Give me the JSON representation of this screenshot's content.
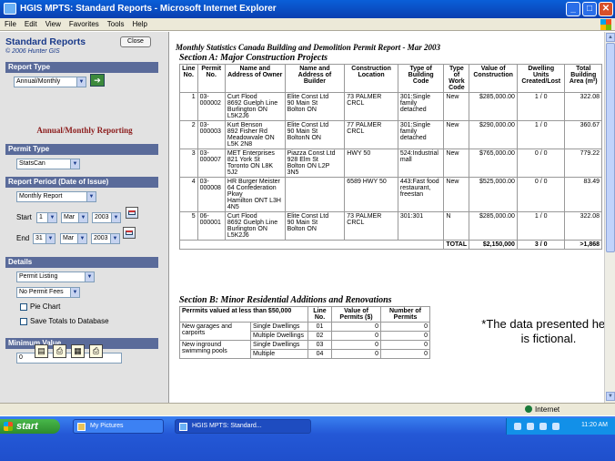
{
  "window": {
    "title": "HGIS MPTS: Standard Reports - Microsoft Internet Explorer"
  },
  "menu": [
    "File",
    "Edit",
    "View",
    "Favorites",
    "Tools",
    "Help"
  ],
  "sidebar": {
    "title": "Standard Reports",
    "copyright": "© 2006 Hunter GIS",
    "close_label": "Close",
    "report_type": {
      "heading": "Report Type",
      "value": "Annual/Monthly"
    },
    "reporting_title": "Annual/Monthly Reporting",
    "permit_type": {
      "heading": "Permit Type",
      "value": "StatsCan"
    },
    "report_period": {
      "heading": "Report Period (Date of Issue)",
      "value": "Monthly Report",
      "start_label": "Start",
      "start_day": "1",
      "start_month": "Mar",
      "start_year": "2003",
      "end_label": "End",
      "end_day": "31",
      "end_month": "Mar",
      "end_year": "2003"
    },
    "details": {
      "heading": "Details",
      "listing": "Permit Listing",
      "fees": "No Permit Fees",
      "pie_chart": "Pie Chart",
      "save_totals": "Save Totals to Database"
    },
    "minimum": {
      "heading": "Minimum Value",
      "value": "0"
    }
  },
  "report": {
    "title": "Monthly Statistics Canada Building and Demolition Permit Report - Mar 2003",
    "section_a": {
      "title": "Section A: Major Construction Projects",
      "headers": [
        "Line No.",
        "Permit No.",
        "Name and Address of Owner",
        "Name and Address of Builder",
        "Construction Location",
        "Type of Building Code",
        "Type of Work Code",
        "Value of Construction",
        "Dwelling Units Created/Lost",
        "Total Building Area (m²)"
      ],
      "rows": [
        [
          "1",
          "03-000002",
          "Curt Flood\n8692 Guelph Line\nBurlington ON\nL5K2J6",
          "Elite Const Ltd\n90 Main St\nBolton ON",
          "73 PALMER CRCL",
          "301:Single family detached",
          "New",
          "$285,000.00",
          "1 / 0",
          "322.08"
        ],
        [
          "2",
          "03-000003",
          "Kurt Benson\n892 Fisher Rd\nMeadowvale ON\nL5K 2N8",
          "Elite Const Ltd\n90 Main St\nBoltonN ON",
          "77 PALMER CRCL",
          "301:Single family detached",
          "New",
          "$290,000.00",
          "1 / 0",
          "360.67"
        ],
        [
          "3",
          "03-000007",
          "MET Enterprises\n821 York St\nToronto ON L8K\n5J2",
          "Piazza Const Ltd\n928 Elm St\nBolton ON L2P 3N5",
          "HWY 50",
          "524:Industrial mall",
          "New",
          "$765,000.00",
          "0 / 0",
          "779.22"
        ],
        [
          "4",
          "03-000008",
          "HR Burger Meister\n64 Confederation\nPkwy\nHamilton ONT L3H\n4N5",
          "",
          "6589 HWY 50",
          "443:Fast food restaurant, freestan",
          "New",
          "$525,000.00",
          "0 / 0",
          "83.49"
        ],
        [
          "5",
          "06-000001",
          "Curt Flood\n8692 Guelph Line\nBurlington ON\nL5K2J6",
          "Elite Const Ltd\n90 Main St\nBolton ON",
          "73 PALMER CRCL",
          "301:301",
          "N",
          "$285,000.00",
          "1 / 0",
          "322.08"
        ]
      ],
      "total": {
        "label": "TOTAL",
        "value": "$2,150,000",
        "dwellings": "3 / 0",
        "area": ">1,868"
      }
    },
    "section_b": {
      "title": "Section B: Minor Residential Additions and Renovations",
      "headers": [
        "Perrmits valued at less than $50,000",
        "Line No.",
        "Value of Permits ($)",
        "Number of Permits"
      ],
      "groups": [
        {
          "label": "New garages and carports",
          "rows": [
            [
              "Single Dwellings",
              "01",
              "0",
              "0"
            ],
            [
              "Multiple Dwellings",
              "02",
              "0",
              "0"
            ]
          ]
        },
        {
          "label": "New inground swimming pools",
          "rows": [
            [
              "Single Dwellings",
              "03",
              "0",
              "0"
            ],
            [
              "Multiple",
              "04",
              "0",
              "0"
            ]
          ]
        }
      ]
    },
    "notice": "*The data presented here is fictional."
  },
  "statusbar": {
    "zone": "Internet"
  },
  "taskbar": {
    "start": "start",
    "tasks": [
      "My Pictures",
      "HGIS MPTS: Standard..."
    ],
    "clock": "11:20 AM"
  }
}
